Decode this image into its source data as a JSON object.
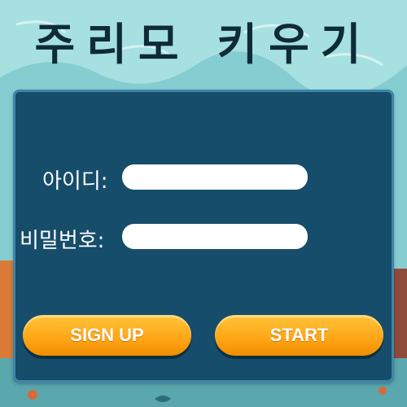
{
  "title": "주리모 키우기",
  "login": {
    "id_label": "아이디:",
    "id_value": "",
    "password_label": "비밀번호:",
    "password_value": ""
  },
  "buttons": {
    "signup_label": "SIGN UP",
    "start_label": "START"
  },
  "colors": {
    "panel": "#154d6b",
    "panel_border": "#3e86aa",
    "button": "#ffa516",
    "title": "#0e2b38"
  }
}
